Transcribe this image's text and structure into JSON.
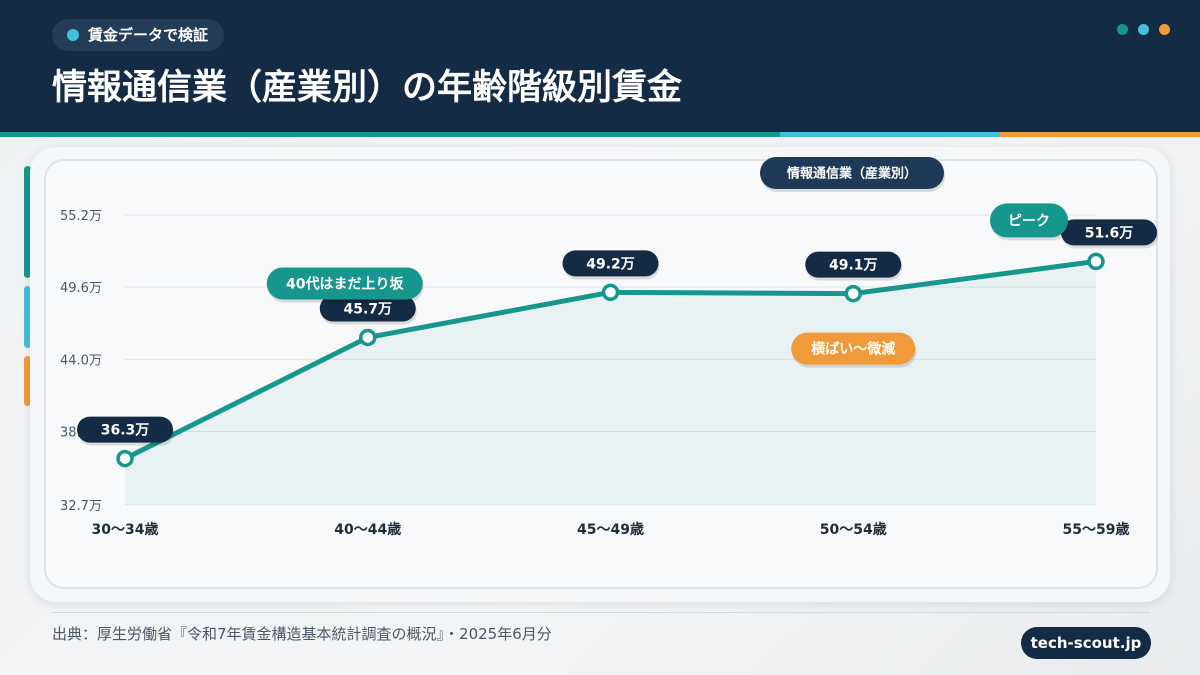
{
  "header": {
    "tag": "賃金データで検証",
    "title": "情報通信業（産業別）の年齢階級別賃金",
    "dot_colors": [
      "#17968e",
      "#46bfd8",
      "#f09a3a"
    ]
  },
  "colors": {
    "navy": "#132b45",
    "teal": "#17968e",
    "cyan": "#46bfd8",
    "orange": "#f09a3a"
  },
  "chart_data": {
    "type": "line",
    "x": [
      "30〜34歳",
      "40〜44歳",
      "45〜49歳",
      "50〜54歳",
      "55〜59歳"
    ],
    "series": [
      {
        "name": "情報通信業（産業別）",
        "values": [
          36.3,
          45.7,
          49.2,
          49.1,
          51.6
        ],
        "labels": [
          "36.3万",
          "45.7万",
          "49.2万",
          "49.1万",
          "51.6万"
        ]
      }
    ],
    "yticks": [
      "55.2万",
      "49.6万",
      "44.0万",
      "38.4万",
      "32.7万"
    ],
    "ytick_values": [
      55.2,
      49.6,
      44.0,
      38.4,
      32.7
    ],
    "ylim": [
      32.7,
      55.2
    ],
    "grid": true,
    "legend": "top-right",
    "annotations": [
      {
        "text": "40代はまだ上り坂",
        "point": 1,
        "color": "#17968e"
      },
      {
        "text": "横ばい〜微減",
        "point": 3,
        "color": "#f09a3a"
      },
      {
        "text": "ピーク",
        "point": 4,
        "color": "#17968e"
      }
    ]
  },
  "footer": {
    "source": "出典：厚生労働省『令和7年賃金構造基本統計調査の概況』・2025年6月分",
    "brand": "tech-scout.jp"
  }
}
